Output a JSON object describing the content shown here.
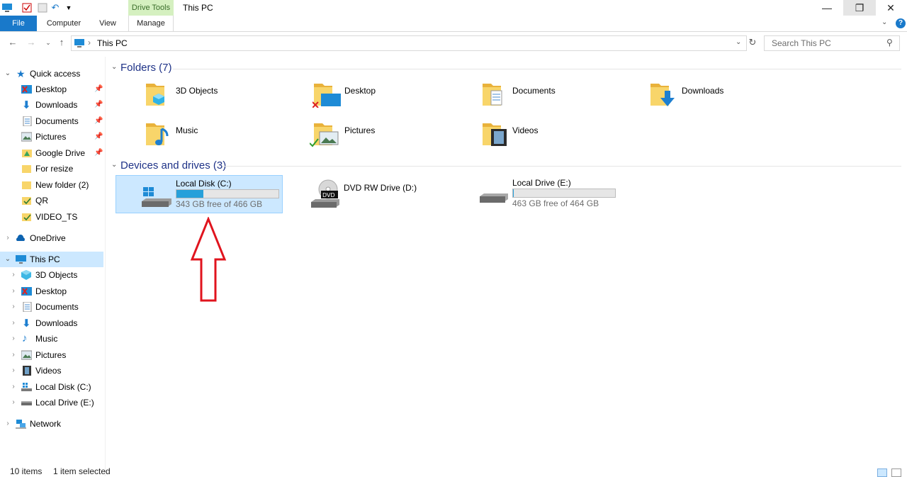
{
  "window": {
    "title": "This PC",
    "context_tab": "Drive Tools"
  },
  "ribbon": {
    "tabs": [
      "File",
      "Computer",
      "View",
      "Manage"
    ]
  },
  "address": {
    "path": "This PC",
    "search_placeholder": "Search This PC"
  },
  "nav": {
    "quick_access": "Quick access",
    "quick_items": [
      "Desktop",
      "Downloads",
      "Documents",
      "Pictures",
      "Google Drive",
      "For resize",
      "New folder (2)",
      "QR",
      "VIDEO_TS"
    ],
    "onedrive": "OneDrive",
    "this_pc": "This PC",
    "pc_items": [
      "3D Objects",
      "Desktop",
      "Documents",
      "Downloads",
      "Music",
      "Pictures",
      "Videos",
      "Local Disk (C:)",
      "Local Drive (E:)"
    ],
    "network": "Network"
  },
  "folders": {
    "header": "Folders (7)",
    "items": [
      "3D Objects",
      "Desktop",
      "Documents",
      "Downloads",
      "Music",
      "Pictures",
      "Videos"
    ]
  },
  "devices": {
    "header": "Devices and drives (3)",
    "items": [
      {
        "name": "Local Disk (C:)",
        "free_text": "343 GB free of 466 GB",
        "used_fraction": 0.264
      },
      {
        "name": "DVD RW Drive (D:)"
      },
      {
        "name": "Local Drive (E:)",
        "free_text": "463 GB free of 464 GB",
        "used_fraction": 0.002
      }
    ]
  },
  "status": {
    "items": "10 items",
    "selected": "1 item selected"
  },
  "colors": {
    "accent": "#1979ca",
    "folder": "#f8d56a",
    "arrow": "#e0141e",
    "selection": "#cce8ff"
  }
}
